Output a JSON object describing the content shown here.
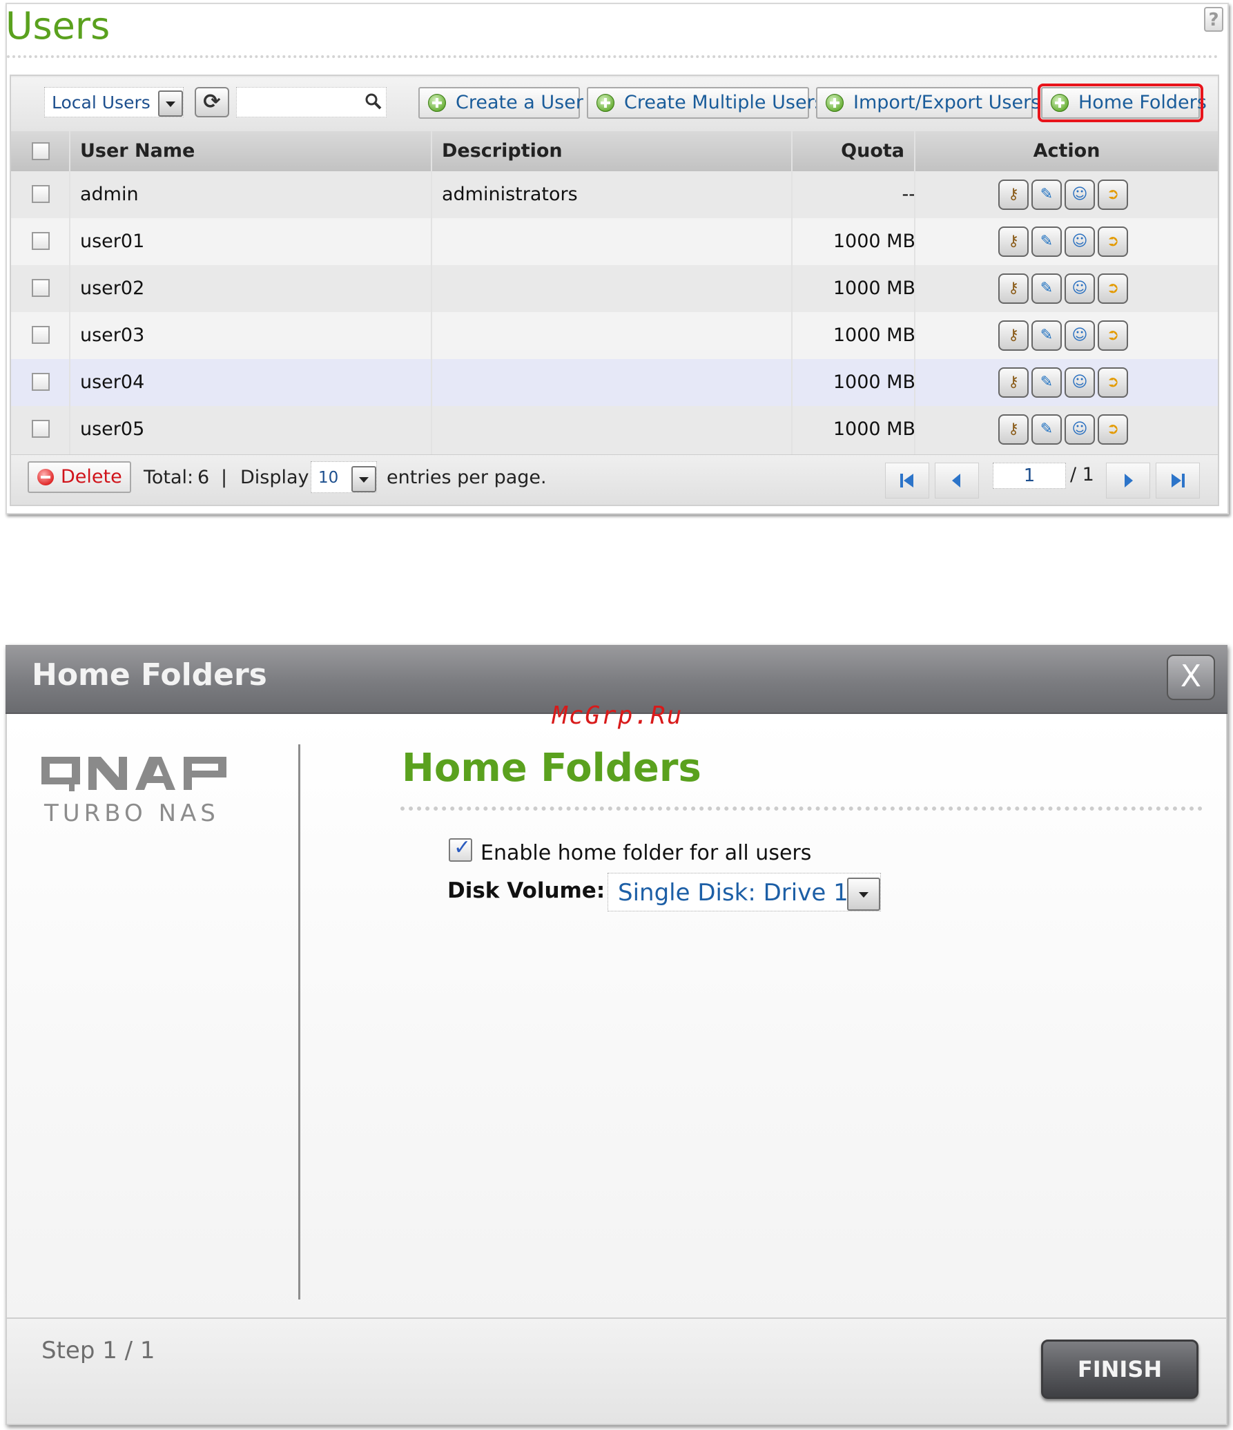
{
  "users_panel": {
    "title": "Users",
    "toolbar": {
      "user_type": "Local Users",
      "search_placeholder": "",
      "create_user": "Create a User",
      "create_multiple": "Create Multiple Users",
      "import_export": "Import/Export Users",
      "home_folders": "Home Folders"
    },
    "table": {
      "headers": {
        "user_name": "User Name",
        "description": "Description",
        "quota": "Quota",
        "action": "Action"
      },
      "rows": [
        {
          "name": "admin",
          "description": "administrators",
          "quota": "--"
        },
        {
          "name": "user01",
          "description": "",
          "quota": "1000 MB"
        },
        {
          "name": "user02",
          "description": "",
          "quota": "1000 MB"
        },
        {
          "name": "user03",
          "description": "",
          "quota": "1000 MB"
        },
        {
          "name": "user04",
          "description": "",
          "quota": "1000 MB"
        },
        {
          "name": "user05",
          "description": "",
          "quota": "1000 MB"
        }
      ]
    },
    "footer": {
      "delete": "Delete",
      "total_label": "Total:",
      "total": "6",
      "sep": "|",
      "display_label": "Display",
      "display_value": "10",
      "per_page": "entries per page.",
      "page": "1",
      "page_total": "/ 1"
    }
  },
  "dialog": {
    "title": "Home Folders",
    "close": "X",
    "watermark": "McGrp.Ru",
    "brand": "QNAP",
    "brand_sub": "TURBO NAS",
    "heading": "Home Folders",
    "enable_label": "Enable home folder for all users",
    "enable_checked": true,
    "disk_label": "Disk Volume:",
    "disk_value": "Single Disk: Drive 1",
    "step": "Step 1 / 1",
    "finish": "FINISH"
  },
  "colors": {
    "accent_green": "#5aa11e",
    "link_blue": "#1a5c9a",
    "highlight_red": "#e8141b"
  }
}
